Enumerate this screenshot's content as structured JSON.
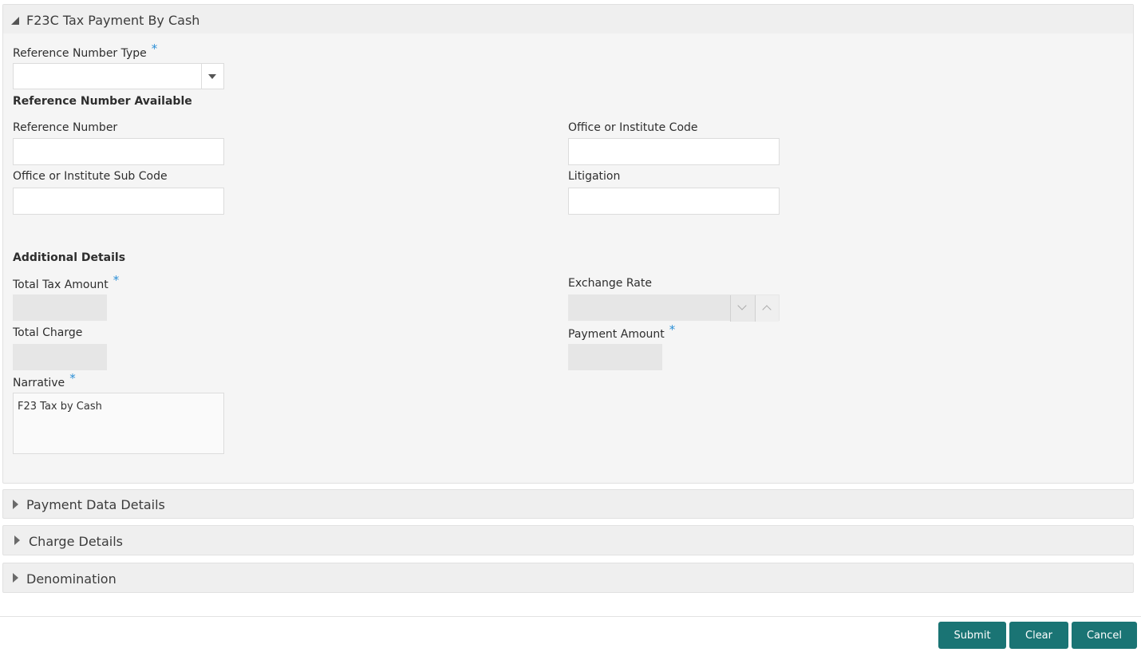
{
  "main_section": {
    "title": "F23C Tax Payment By Cash",
    "fields": {
      "reference_number_type": {
        "label": "Reference Number Type",
        "value": ""
      },
      "reference_number_available_heading": "Reference Number Available",
      "reference_number": {
        "label": "Reference Number",
        "value": ""
      },
      "office_code": {
        "label": "Office or Institute Code",
        "value": ""
      },
      "office_sub_code": {
        "label": "Office or Institute Sub Code",
        "value": ""
      },
      "litigation": {
        "label": "Litigation",
        "value": ""
      },
      "additional_details_heading": "Additional Details",
      "total_tax_amount": {
        "label": "Total Tax Amount",
        "value": ""
      },
      "exchange_rate": {
        "label": "Exchange Rate",
        "value": ""
      },
      "total_charge": {
        "label": "Total Charge",
        "value": ""
      },
      "payment_amount": {
        "label": "Payment Amount",
        "value": ""
      },
      "narrative": {
        "label": "Narrative",
        "value": "F23 Tax by Cash"
      }
    },
    "required_marker": "*"
  },
  "collapsed_sections": [
    {
      "title": "Payment Data Details"
    },
    {
      "title": "Charge Details"
    },
    {
      "title": "Denomination"
    }
  ],
  "footer": {
    "submit_label": "Submit",
    "clear_label": "Clear",
    "cancel_label": "Cancel"
  },
  "colors": {
    "button": "#1a7474",
    "required_marker": "#2c8fd6",
    "panel_background": "#f5f5f5"
  },
  "icons": {
    "expanded_section": "triangle-down-icon",
    "collapsed_section": "triangle-right-icon",
    "dropdown": "caret-down-icon",
    "stepper_down": "chevron-down-icon",
    "stepper_up": "chevron-up-icon"
  }
}
